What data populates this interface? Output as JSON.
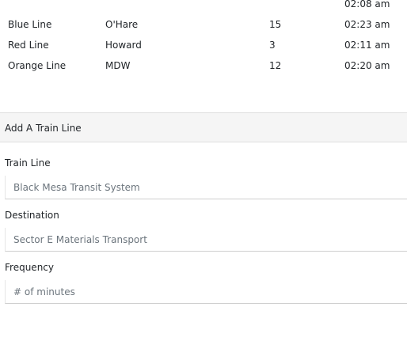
{
  "schedule": {
    "rows": [
      {
        "name": "",
        "destination": "",
        "frequency": "",
        "next_arrival": "02:08 am"
      },
      {
        "name": "Blue Line",
        "destination": "O'Hare",
        "frequency": "15",
        "next_arrival": "02:23 am"
      },
      {
        "name": "Red Line",
        "destination": "Howard",
        "frequency": "3",
        "next_arrival": "02:11 am"
      },
      {
        "name": "Orange Line",
        "destination": "MDW",
        "frequency": "12",
        "next_arrival": "02:20 am"
      }
    ]
  },
  "add_panel": {
    "title": "Add A Train Line",
    "fields": {
      "train_line": {
        "label": "Train Line",
        "placeholder": "Black Mesa Transit System"
      },
      "destination": {
        "label": "Destination",
        "placeholder": "Sector E Materials Transport"
      },
      "frequency": {
        "label": "Frequency",
        "placeholder": "# of minutes"
      }
    }
  }
}
